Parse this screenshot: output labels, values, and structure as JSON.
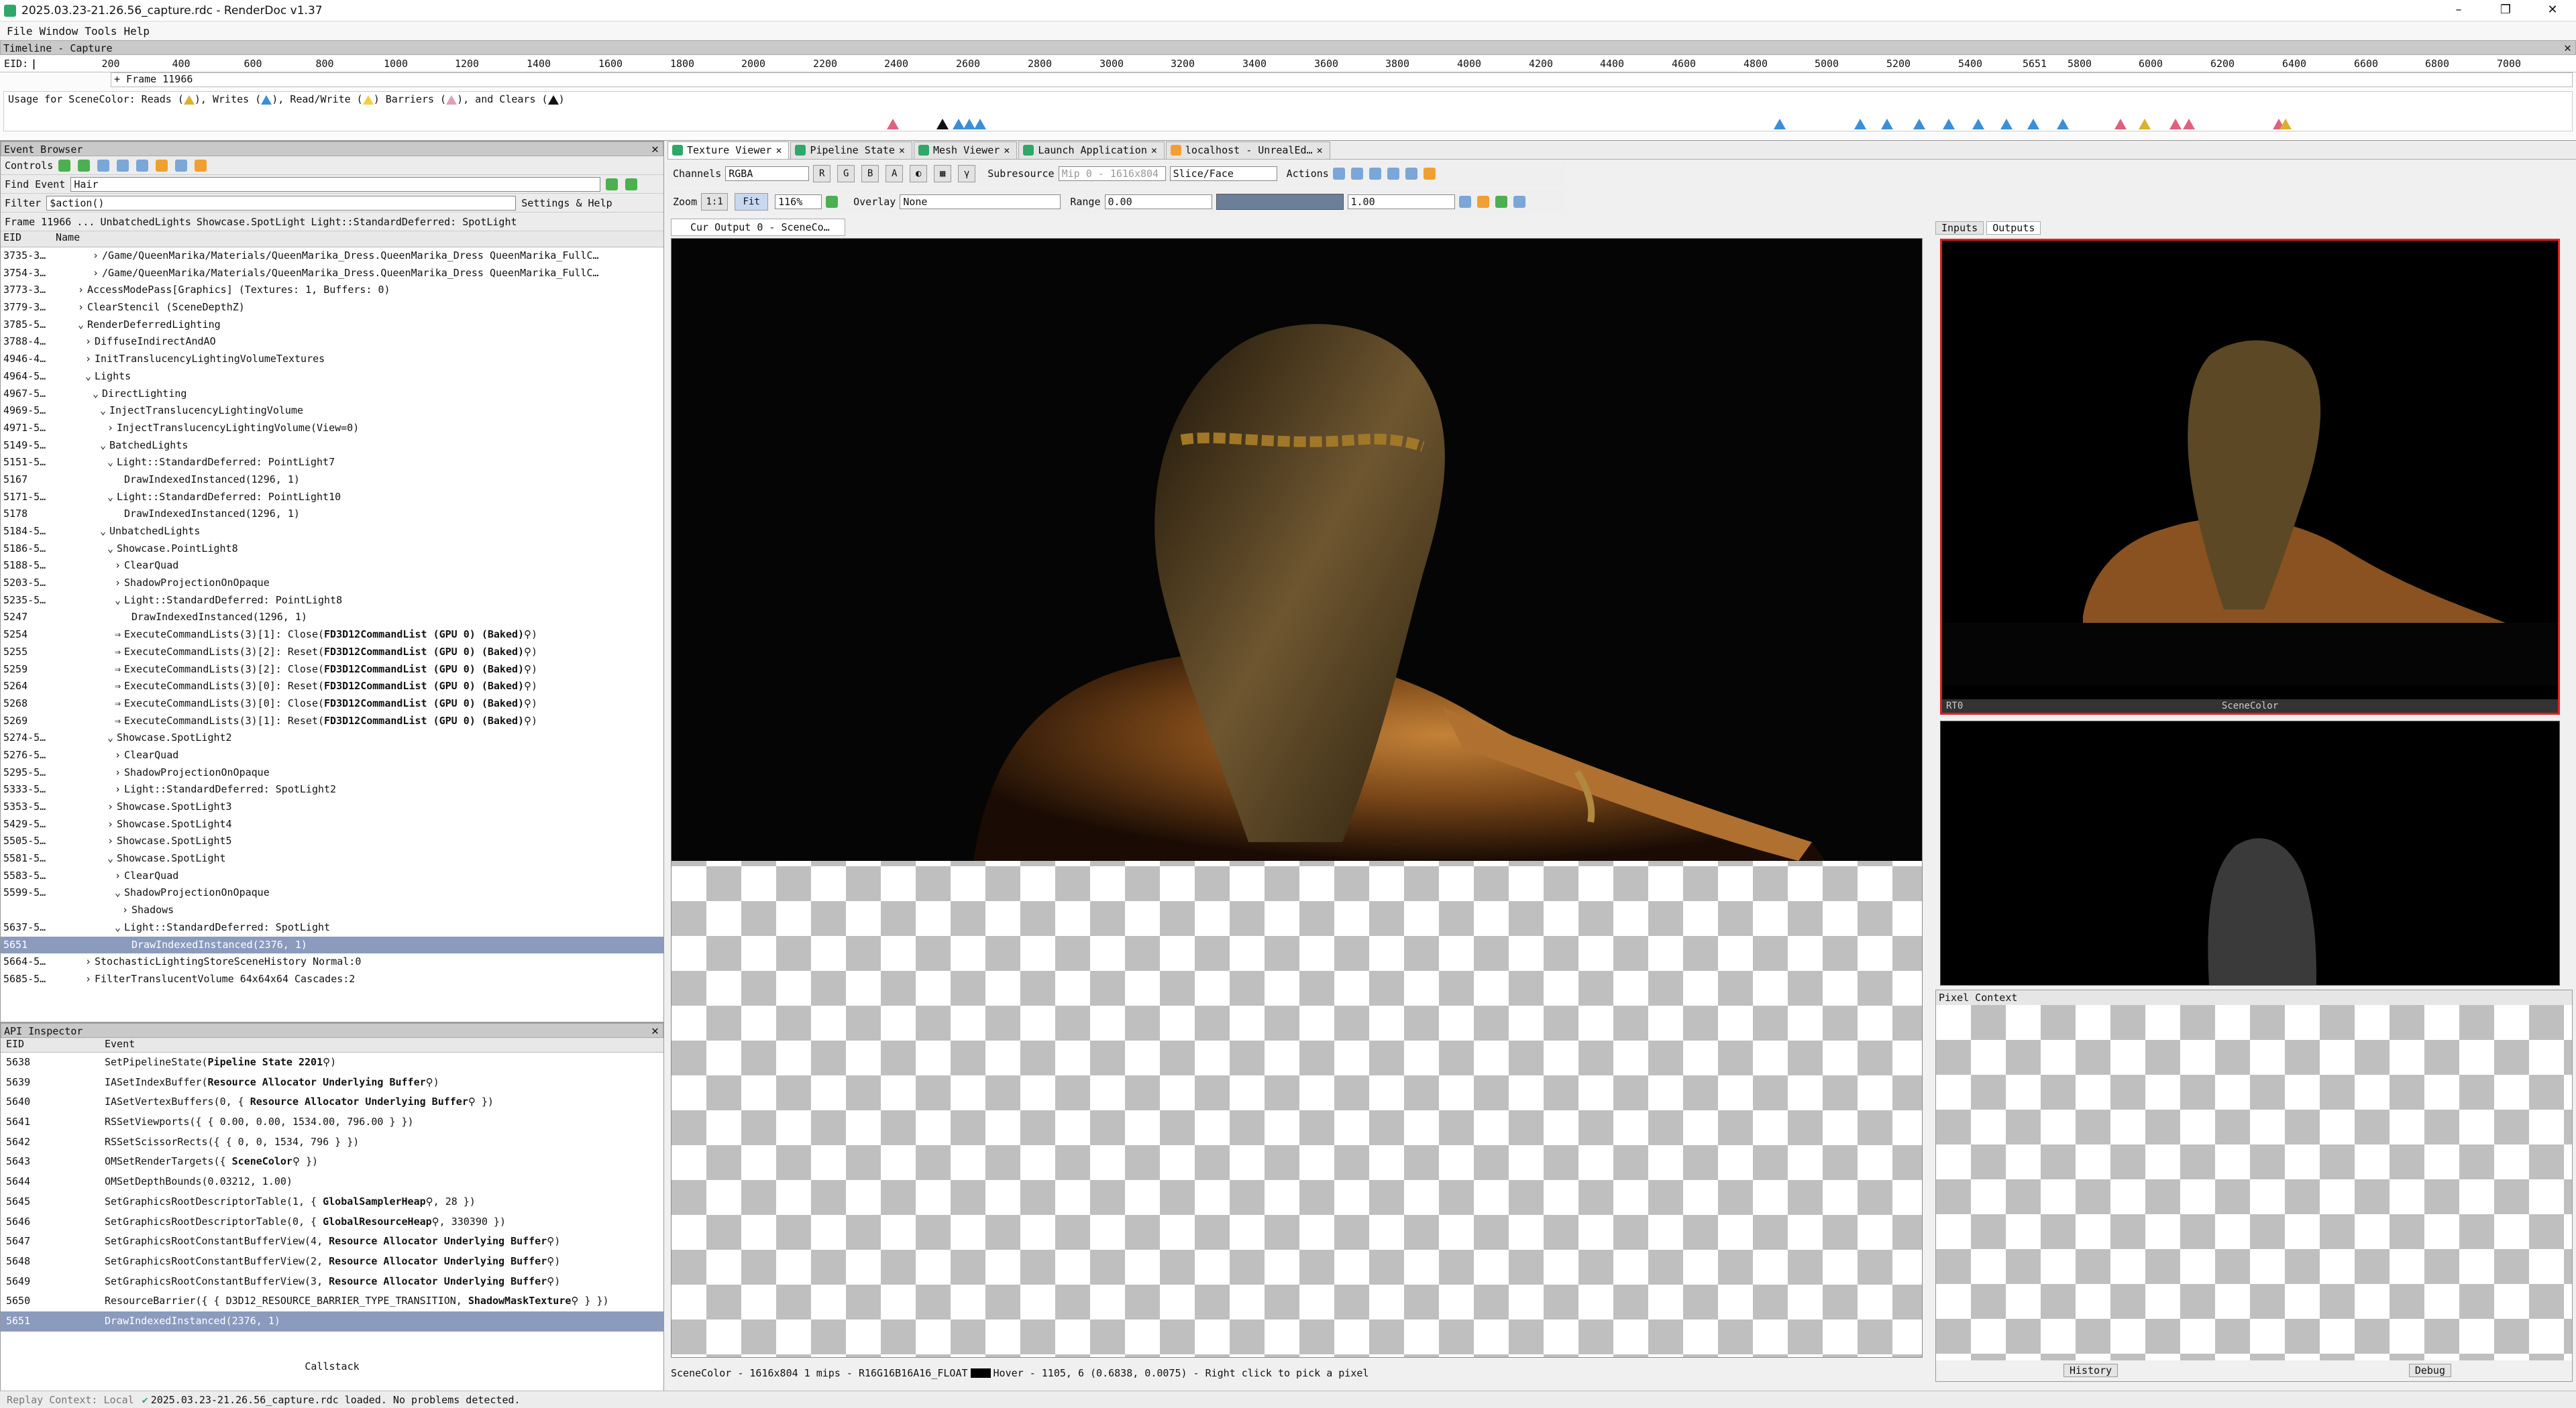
{
  "window": {
    "title": "2025.03.23-21.26.56_capture.rdc - RenderDoc v1.37",
    "controls": [
      "–",
      "❐",
      "✕"
    ]
  },
  "menu": [
    "File",
    "Window",
    "Tools",
    "Help"
  ],
  "timeline": {
    "title": "Timeline - Capture",
    "eid_label": "EID:",
    "ticks": [
      "200",
      "400",
      "600",
      "800",
      "1000",
      "1200",
      "1400",
      "1600",
      "1800",
      "2000",
      "2200",
      "2400",
      "2600",
      "2800",
      "3000",
      "3200",
      "3400",
      "3600",
      "3800",
      "4000",
      "4200",
      "4400",
      "4600",
      "4800",
      "5000",
      "5200",
      "5400",
      "5651",
      "5800",
      "6000",
      "6200",
      "6400",
      "6600",
      "6800",
      "7000"
    ],
    "frame_label": "+ Frame 11966",
    "usage": {
      "p1": "Usage for SceneColor: Reads (",
      "p2": "), Writes (",
      "p3": "), Read/Write (",
      "p4": ") Barriers (",
      "p5": "), and Clears (",
      "p6": ")"
    }
  },
  "event_browser": {
    "title": "Event Browser",
    "controls_label": "Controls",
    "find_label": "Find Event",
    "find_value": "Hair",
    "filter_label": "Filter",
    "filter_value": "$action()",
    "settings_label": "Settings & Help",
    "breadcrumb": [
      "Frame 11966",
      "...",
      "UnbatchedLights",
      "Showcase.SpotLight",
      "Light::StandardDeferred: SpotLight"
    ],
    "col_eid": "EID",
    "col_name": "Name",
    "rows": [
      {
        "eid": "3735-3…",
        "indent": 5,
        "arrow": "›",
        "name": "/Game/QueenMarika/Materials/QueenMarika_Dress.QueenMarika_Dress QueenMarika_FullC…"
      },
      {
        "eid": "3754-3…",
        "indent": 5,
        "arrow": "›",
        "name": "/Game/QueenMarika/Materials/QueenMarika_Dress.QueenMarika_Dress QueenMarika_FullC…"
      },
      {
        "eid": "3773-3…",
        "indent": 3,
        "arrow": "›",
        "name": "AccessModePass[Graphics] (Textures: 1, Buffers: 0)"
      },
      {
        "eid": "3779-3…",
        "indent": 3,
        "arrow": "›",
        "name": "ClearStencil (SceneDepthZ)"
      },
      {
        "eid": "3785-5…",
        "indent": 3,
        "arrow": "⌄",
        "name": "RenderDeferredLighting"
      },
      {
        "eid": "3788-4…",
        "indent": 4,
        "arrow": "›",
        "name": "DiffuseIndirectAndAO"
      },
      {
        "eid": "4946-4…",
        "indent": 4,
        "arrow": "›",
        "name": "InitTranslucencyLightingVolumeTextures"
      },
      {
        "eid": "4964-5…",
        "indent": 4,
        "arrow": "⌄",
        "name": "Lights"
      },
      {
        "eid": "4967-5…",
        "indent": 5,
        "arrow": "⌄",
        "name": "DirectLighting"
      },
      {
        "eid": "4969-5…",
        "indent": 6,
        "arrow": "⌄",
        "name": "InjectTranslucencyLightingVolume"
      },
      {
        "eid": "4971-5…",
        "indent": 7,
        "arrow": "›",
        "name": "InjectTranslucencyLightingVolume(View=0)"
      },
      {
        "eid": "5149-5…",
        "indent": 6,
        "arrow": "⌄",
        "name": "BatchedLights"
      },
      {
        "eid": "5151-5…",
        "indent": 7,
        "arrow": "⌄",
        "name": "Light::StandardDeferred: PointLight7"
      },
      {
        "eid": "5167",
        "indent": 8,
        "arrow": "",
        "name": "DrawIndexedInstanced(1296, 1)"
      },
      {
        "eid": "5171-5…",
        "indent": 7,
        "arrow": "⌄",
        "name": "Light::StandardDeferred: PointLight10"
      },
      {
        "eid": "5178",
        "indent": 8,
        "arrow": "",
        "name": "DrawIndexedInstanced(1296, 1)"
      },
      {
        "eid": "5184-5…",
        "indent": 6,
        "arrow": "⌄",
        "name": "UnbatchedLights"
      },
      {
        "eid": "5186-5…",
        "indent": 7,
        "arrow": "⌄",
        "name": "Showcase.PointLight8"
      },
      {
        "eid": "5188-5…",
        "indent": 8,
        "arrow": "›",
        "name": "ClearQuad"
      },
      {
        "eid": "5203-5…",
        "indent": 8,
        "arrow": "›",
        "name": "ShadowProjectionOnOpaque"
      },
      {
        "eid": "5235-5…",
        "indent": 8,
        "arrow": "⌄",
        "name": "Light::StandardDeferred: PointLight8"
      },
      {
        "eid": "5247",
        "indent": 9,
        "arrow": "",
        "name": "DrawIndexedInstanced(1296, 1)"
      },
      {
        "eid": "5254",
        "indent": 8,
        "arrow": "⇒",
        "name": "ExecuteCommandLists(3)[1]:  Close(",
        "bold": "FD3D12CommandList (GPU 0) (Baked)",
        "tail": "⚲)"
      },
      {
        "eid": "5255",
        "indent": 8,
        "arrow": "⇒",
        "name": "ExecuteCommandLists(3)[2]:  Reset(",
        "bold": "FD3D12CommandList (GPU 0) (Baked)",
        "tail": "⚲)"
      },
      {
        "eid": "5259",
        "indent": 8,
        "arrow": "⇒",
        "name": "ExecuteCommandLists(3)[2]:  Close(",
        "bold": "FD3D12CommandList (GPU 0) (Baked)",
        "tail": "⚲)"
      },
      {
        "eid": "5264",
        "indent": 8,
        "arrow": "⇒",
        "name": "ExecuteCommandLists(3)[0]:  Reset(",
        "bold": "FD3D12CommandList (GPU 0) (Baked)",
        "tail": "⚲)"
      },
      {
        "eid": "5268",
        "indent": 8,
        "arrow": "⇒",
        "name": "ExecuteCommandLists(3)[0]:  Close(",
        "bold": "FD3D12CommandList (GPU 0) (Baked)",
        "tail": "⚲)"
      },
      {
        "eid": "5269",
        "indent": 8,
        "arrow": "⇒",
        "name": "ExecuteCommandLists(3)[1]:  Reset(",
        "bold": "FD3D12CommandList (GPU 0) (Baked)",
        "tail": "⚲)"
      },
      {
        "eid": "5274-5…",
        "indent": 7,
        "arrow": "⌄",
        "name": "Showcase.SpotLight2"
      },
      {
        "eid": "5276-5…",
        "indent": 8,
        "arrow": "›",
        "name": "ClearQuad"
      },
      {
        "eid": "5295-5…",
        "indent": 8,
        "arrow": "›",
        "name": "ShadowProjectionOnOpaque"
      },
      {
        "eid": "5333-5…",
        "indent": 8,
        "arrow": "›",
        "name": "Light::StandardDeferred: SpotLight2"
      },
      {
        "eid": "5353-5…",
        "indent": 7,
        "arrow": "›",
        "name": "Showcase.SpotLight3"
      },
      {
        "eid": "5429-5…",
        "indent": 7,
        "arrow": "›",
        "name": "Showcase.SpotLight4"
      },
      {
        "eid": "5505-5…",
        "indent": 7,
        "arrow": "›",
        "name": "Showcase.SpotLight5"
      },
      {
        "eid": "5581-5…",
        "indent": 7,
        "arrow": "⌄",
        "name": "Showcase.SpotLight"
      },
      {
        "eid": "5583-5…",
        "indent": 8,
        "arrow": "›",
        "name": "ClearQuad"
      },
      {
        "eid": "5599-5…",
        "indent": 8,
        "arrow": "⌄",
        "name": "ShadowProjectionOnOpaque"
      },
      {
        "eid": "",
        "indent": 9,
        "arrow": "›",
        "name": "Shadows"
      },
      {
        "eid": "5637-5…",
        "indent": 8,
        "arrow": "⌄",
        "name": "Light::StandardDeferred: SpotLight"
      },
      {
        "eid": "5651",
        "indent": 9,
        "arrow": "",
        "name": "DrawIndexedInstanced(2376, 1)",
        "selected": true
      },
      {
        "eid": "5664-5…",
        "indent": 4,
        "arrow": "›",
        "name": "StochasticLightingStoreSceneHistory Normal:0"
      },
      {
        "eid": "5685-5…",
        "indent": 4,
        "arrow": "›",
        "name": "FilterTranslucentVolume 64x64x64 Cascades:2"
      }
    ]
  },
  "api_inspector": {
    "title": "API Inspector",
    "col_eid": "EID",
    "col_event": "Event",
    "callstack_label": "Callstack",
    "rows": [
      {
        "eid": "5638",
        "pre": "SetPipelineState(",
        "bold": "Pipeline State 2201",
        "post": "⚲)"
      },
      {
        "eid": "5639",
        "pre": "IASetIndexBuffer(",
        "bold": "Resource Allocator Underlying Buffer",
        "post": "⚲)"
      },
      {
        "eid": "5640",
        "pre": "IASetVertexBuffers(0,  {  ",
        "bold": "Resource Allocator Underlying Buffer",
        "post": "⚲  })"
      },
      {
        "eid": "5641",
        "pre": "RSSetViewports({ { 0.00, 0.00, 1534.00, 796.00 } })",
        "bold": "",
        "post": ""
      },
      {
        "eid": "5642",
        "pre": "RSSetScissorRects({ { 0, 0, 1534, 796 } })",
        "bold": "",
        "post": ""
      },
      {
        "eid": "5643",
        "pre": "OMSetRenderTargets({  ",
        "bold": "SceneColor",
        "post": "⚲  })"
      },
      {
        "eid": "5644",
        "pre": "OMSetDepthBounds(0.03212, 1.00)",
        "bold": "",
        "post": ""
      },
      {
        "eid": "5645",
        "pre": "SetGraphicsRootDescriptorTable(1,  {  ",
        "bold": "GlobalSamplerHeap",
        "post": "⚲,  28  })"
      },
      {
        "eid": "5646",
        "pre": "SetGraphicsRootDescriptorTable(0,  {  ",
        "bold": "GlobalResourceHeap",
        "post": "⚲,  330390  })"
      },
      {
        "eid": "5647",
        "pre": "SetGraphicsRootConstantBufferView(4,  ",
        "bold": "Resource Allocator Underlying Buffer",
        "post": "⚲)"
      },
      {
        "eid": "5648",
        "pre": "SetGraphicsRootConstantBufferView(2,  ",
        "bold": "Resource Allocator Underlying Buffer",
        "post": "⚲)"
      },
      {
        "eid": "5649",
        "pre": "SetGraphicsRootConstantBufferView(3,  ",
        "bold": "Resource Allocator Underlying Buffer",
        "post": "⚲)"
      },
      {
        "eid": "5650",
        "pre": "ResourceBarrier({  {  D3D12_RESOURCE_BARRIER_TYPE_TRANSITION,  ",
        "bold": "ShadowMaskTexture",
        "post": "⚲  }  })"
      },
      {
        "eid": "5651",
        "pre": "DrawIndexedInstanced(2376, 1)",
        "bold": "",
        "post": "",
        "selected": true
      }
    ]
  },
  "tabs": [
    {
      "label": "Texture Viewer",
      "active": true
    },
    {
      "label": "Pipeline State"
    },
    {
      "label": "Mesh Viewer"
    },
    {
      "label": "Launch Application"
    },
    {
      "label": "localhost - UnrealEd…"
    }
  ],
  "texture_viewer": {
    "channels_label": "Channels",
    "channels_value": "RGBA",
    "channel_buttons": [
      "R",
      "G",
      "B",
      "A"
    ],
    "subresource_label": "Subresource",
    "mip_value": "Mip 0 - 1616x804",
    "slice_value": "Slice/Face",
    "actions_label": "Actions",
    "zoom_label": "Zoom",
    "zoom_fit": "1:1",
    "fit_label": "Fit",
    "zoom_value": "116%",
    "overlay_label": "Overlay",
    "overlay_value": "None",
    "range_label": "Range",
    "range_min": "0.00",
    "range_max": "1.00",
    "view_tab": "Cur Output 0 - SceneCo…",
    "status": "SceneColor - 1616x804 1 mips - R16G16B16A16_FLOAT",
    "hover": "Hover -  1105,   6 (0.6838, 0.0075) - Right click to pick a pixel"
  },
  "right_panel": {
    "tab_inputs": "Inputs",
    "tab_outputs": "Outputs",
    "thumb1_left": "RT0",
    "thumb1_caption": "SceneColor",
    "pixel_context_title": "Pixel Context",
    "history_label": "History",
    "debug_label": "Debug"
  },
  "statusbar": {
    "replay": "Replay Context: Local",
    "message": "2025.03.23-21.26.56_capture.rdc loaded. No problems detected."
  },
  "colors": {
    "accent_green": "#2fa86a",
    "selection": "#8a9bbd",
    "thumb_border": "#e02020",
    "read": "#3a8fd8",
    "write": "#e06080",
    "read_write": "#d9b030",
    "clear": "#111111"
  }
}
